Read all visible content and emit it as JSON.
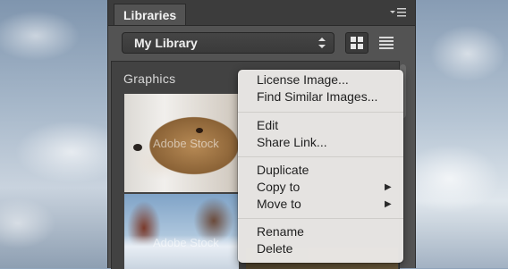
{
  "panel": {
    "tab_label": "Libraries",
    "library_select": {
      "value": "My Library"
    },
    "section_title": "Graphics"
  },
  "thumbnails": [
    {
      "watermark": "Adobe Stock"
    },
    {
      "watermark": "Adobe Stock"
    }
  ],
  "context_menu": {
    "items": [
      {
        "label": "License Image..."
      },
      {
        "label": "Find Similar Images..."
      },
      {
        "label": "Edit"
      },
      {
        "label": "Share Link..."
      },
      {
        "label": "Duplicate"
      },
      {
        "label": "Copy to",
        "submenu": true
      },
      {
        "label": "Move to",
        "submenu": true
      },
      {
        "label": "Rename"
      },
      {
        "label": "Delete"
      }
    ]
  },
  "icons": {
    "panel_menu": "flyout-menu-icon",
    "select_arrows": "up-down-arrows-icon",
    "grid_view": "grid-view-icon",
    "list_view": "list-view-icon",
    "submenu_arrow": "triangle-right-icon"
  },
  "colors": {
    "panel_bg": "#535353",
    "content_bg": "#424242",
    "menu_bg": "#eceae8",
    "menu_text": "#1f1f1f"
  }
}
